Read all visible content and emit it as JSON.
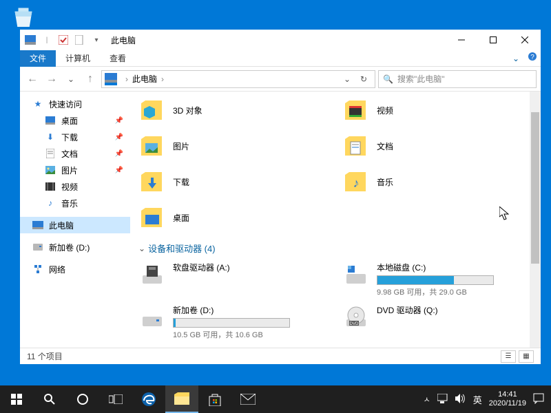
{
  "desktop": {
    "recycle_bin": "回收站"
  },
  "window": {
    "title": "此电脑",
    "tabs": {
      "file": "文件",
      "computer": "计算机",
      "view": "查看"
    },
    "breadcrumb": "此电脑",
    "search_placeholder": "搜索\"此电脑\"",
    "status": "11 个项目"
  },
  "sidebar": {
    "quick_access": "快速访问",
    "desktop": "桌面",
    "downloads": "下载",
    "documents": "文档",
    "pictures": "图片",
    "videos": "视频",
    "music": "音乐",
    "this_pc": "此电脑",
    "new_volume_d": "新加卷 (D:)",
    "network": "网络"
  },
  "folders": {
    "objects3d": "3D 对象",
    "videos": "视频",
    "pictures": "图片",
    "documents": "文档",
    "downloads": "下载",
    "music": "音乐",
    "desktop": "桌面"
  },
  "section": {
    "devices": "设备和驱动器 (4)"
  },
  "drives": {
    "floppy": {
      "name": "软盘驱动器 (A:)"
    },
    "c": {
      "name": "本地磁盘 (C:)",
      "stat": "9.98 GB 可用，共 29.0 GB",
      "fill_pct": 66
    },
    "d": {
      "name": "新加卷 (D:)",
      "stat": "10.5 GB 可用，共 10.6 GB",
      "fill_pct": 2
    },
    "dvd": {
      "name": "DVD 驱动器 (Q:)"
    }
  },
  "taskbar": {
    "ime": "英",
    "time": "14:41",
    "date": "2020/11/19"
  }
}
